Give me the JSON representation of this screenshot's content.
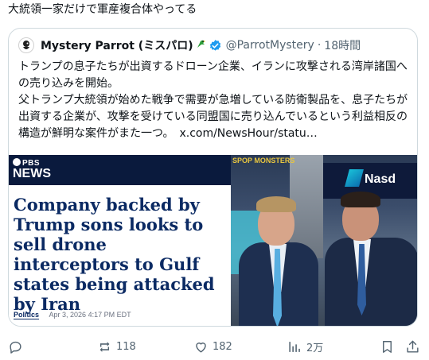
{
  "post": {
    "text": "大統領一家だけで軍産複合体やってる"
  },
  "quote": {
    "author_name": "Mystery Parrot (ミスパロ)",
    "handle": "@ParrotMystery",
    "separator": "·",
    "time": "18時間",
    "body_line1": "トランプの息子たちが出資するドローン企業、イランに攻撃される湾岸諸国への売り込みを開始。",
    "body_line2": "父トランプ大統領が始めた戦争で需要が急増している防衛製品を、息子たちが出資する企業が、攻撃を受けている同盟国に売り込んでいるという利益相反の構造が鮮明な案件がまた一つ。",
    "link": "x.com/NewsHour/statu…",
    "icons": {
      "avatar": "parrot-avatar-icon",
      "emoji": "parrot-emoji-icon",
      "verified": "verified-badge-icon"
    }
  },
  "media": {
    "brand_top": "PBS",
    "brand_bottom": "NEWS",
    "headline": "Company backed by Trump sons looks to sell drone interceptors to Gulf states being attacked by Iran",
    "category": "Politics",
    "date": "Apr 3, 2026 4:17 PM EDT",
    "photo_sign": "Nasd",
    "photo_sign_top": "SPOP MONSTERS",
    "colors": {
      "band": "#0a1a3d",
      "headline": "#0b2a63"
    }
  },
  "actions": {
    "reply": {
      "icon": "reply-icon",
      "count": ""
    },
    "repost": {
      "icon": "repost-icon",
      "count": "118"
    },
    "like": {
      "icon": "like-icon",
      "count": "182"
    },
    "views": {
      "icon": "views-icon",
      "count": "2万"
    },
    "bookmark": {
      "icon": "bookmark-icon"
    },
    "share": {
      "icon": "share-icon"
    }
  }
}
